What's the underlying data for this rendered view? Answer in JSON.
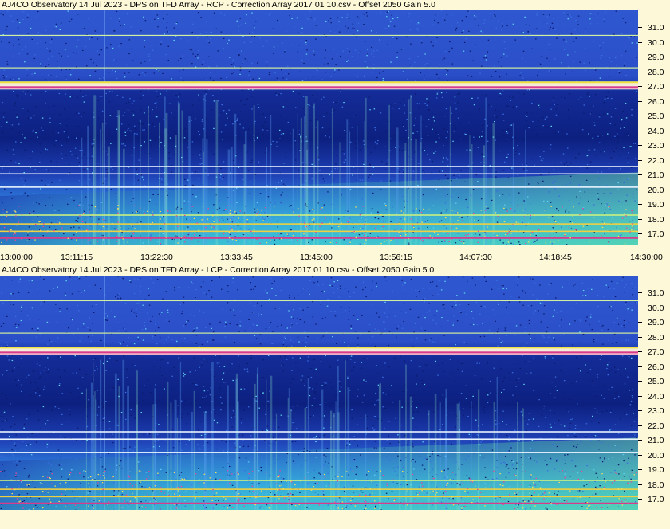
{
  "panels": [
    {
      "title": "AJ4CO Observatory 14 Jul 2023  -  DPS on TFD Array  -  RCP  -  Correction Array 2017 01 10.csv  -  Offset 2050  Gain 5.0",
      "polarization": "RCP"
    },
    {
      "title": "AJ4CO Observatory 14 Jul 2023  -  DPS on TFD Array  -  LCP  -  Correction Array 2017 01 10.csv  -  Offset 2050  Gain 5.0",
      "polarization": "LCP"
    }
  ],
  "frequency_axis": {
    "labels": [
      "31.0",
      "30.0",
      "29.0",
      "28.0",
      "27.0",
      "26.0",
      "25.0",
      "24.0",
      "23.0",
      "22.0",
      "21.0",
      "20.0",
      "19.0",
      "18.0",
      "17.0"
    ],
    "min": 16.3,
    "max": 32.2
  },
  "time_axis": {
    "labels": [
      "13:00:00",
      "13:11:15",
      "13:22:30",
      "13:33:45",
      "13:45:00",
      "13:56:15",
      "14:07:30",
      "14:18:45",
      "14:30:00"
    ]
  },
  "colors": {
    "background": "#fdf8d8",
    "spectrogram_dark": "#0a1e7a",
    "spectrogram_mid": "#2446c0",
    "spectrogram_light": "#3fb8e8",
    "spectrogram_hot": "#d83a8c",
    "spectrogram_warm": "#f0e040"
  },
  "features": {
    "interference_bands_mhz": [
      27.1,
      21.6,
      21.1,
      20.2,
      18.3,
      17.7,
      17.2
    ],
    "bright_lines_mhz": [
      30.5,
      28.3
    ]
  }
}
